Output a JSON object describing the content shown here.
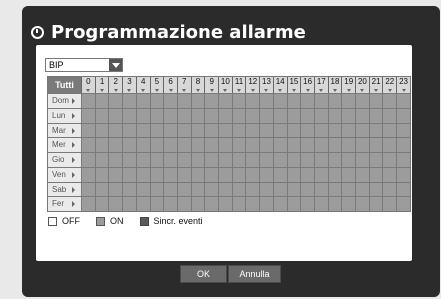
{
  "title": "Programmazione allarme",
  "select": {
    "value": "BIP"
  },
  "grid": {
    "corner_label": "Tutti",
    "hours": [
      "0",
      "1",
      "2",
      "3",
      "4",
      "5",
      "6",
      "7",
      "8",
      "9",
      "10",
      "11",
      "12",
      "13",
      "14",
      "15",
      "16",
      "17",
      "18",
      "19",
      "20",
      "21",
      "22",
      "23"
    ],
    "days": [
      "Dom",
      "Lun",
      "Mar",
      "Mer",
      "Gio",
      "Ven",
      "Sab",
      "Fer"
    ]
  },
  "legend": {
    "off": "OFF",
    "on": "ON",
    "events": "Sincr. eventi"
  },
  "buttons": {
    "ok": "OK",
    "cancel": "Annulla"
  }
}
